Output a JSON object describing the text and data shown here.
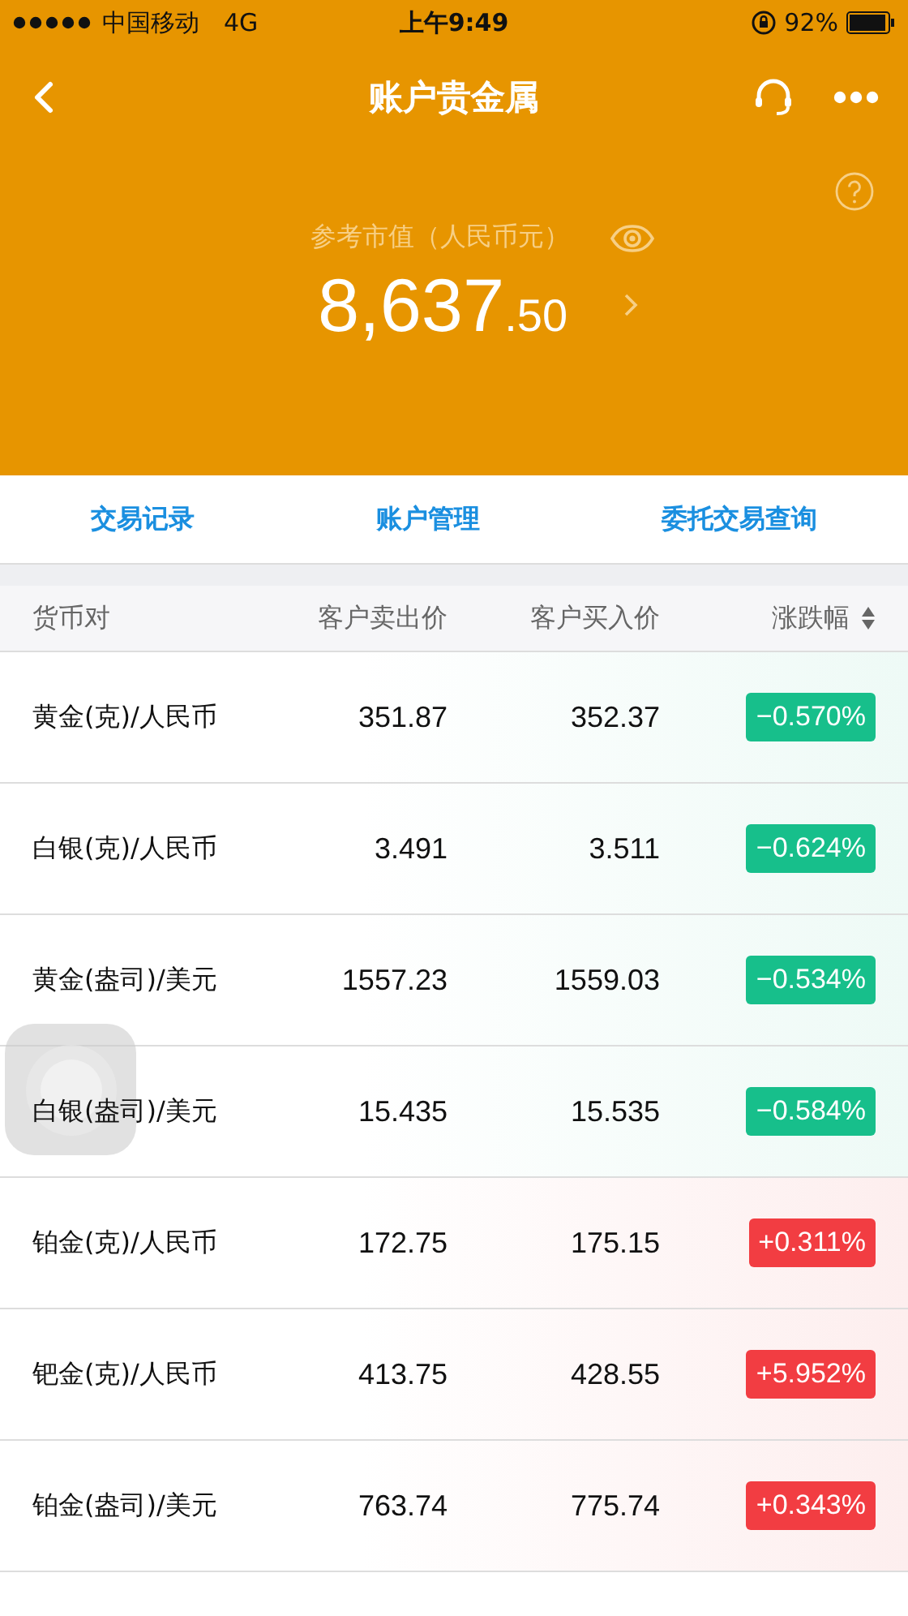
{
  "status_bar": {
    "carrier": "中国移动",
    "network": "4G",
    "time": "上午9:49",
    "battery": "92%"
  },
  "nav": {
    "title": "账户贵金属"
  },
  "summary": {
    "label": "参考市值（人民币元）",
    "value_int": "8,637",
    "value_dec": ".50"
  },
  "tabs": [
    {
      "label": "交易记录"
    },
    {
      "label": "账户管理"
    },
    {
      "label": "委托交易查询"
    }
  ],
  "table": {
    "columns": [
      "货币对",
      "客户卖出价",
      "客户买入价",
      "涨跌幅"
    ],
    "rows": [
      {
        "pair": "黄金(克)/人民币",
        "sell": "351.87",
        "buy": "352.37",
        "change": "−0.570%",
        "kind": "down"
      },
      {
        "pair": "白银(克)/人民币",
        "sell": "3.491",
        "buy": "3.511",
        "change": "−0.624%",
        "kind": "down"
      },
      {
        "pair": "黄金(盎司)/美元",
        "sell": "1557.23",
        "buy": "1559.03",
        "change": "−0.534%",
        "kind": "down"
      },
      {
        "pair": "白银(盎司)/美元",
        "sell": "15.435",
        "buy": "15.535",
        "change": "−0.584%",
        "kind": "down"
      },
      {
        "pair": "铂金(克)/人民币",
        "sell": "172.75",
        "buy": "175.15",
        "change": "+0.311%",
        "kind": "up"
      },
      {
        "pair": "钯金(克)/人民币",
        "sell": "413.75",
        "buy": "428.55",
        "change": "+5.952%",
        "kind": "up"
      },
      {
        "pair": "铂金(盎司)/美元",
        "sell": "763.74",
        "buy": "775.74",
        "change": "+0.343%",
        "kind": "up"
      }
    ]
  }
}
